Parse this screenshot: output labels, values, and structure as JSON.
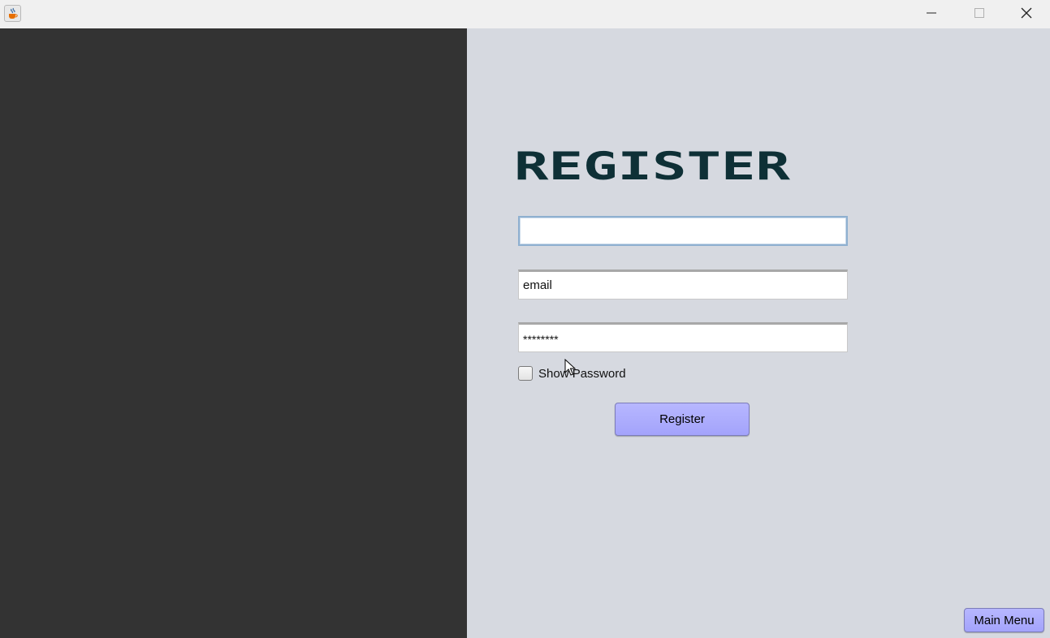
{
  "titlebar": {
    "app_icon": "java-cup-icon",
    "minimize_icon": "minimize-icon",
    "maximize_icon": "maximize-icon",
    "close_icon": "close-icon"
  },
  "form": {
    "title": "REGISTER",
    "username": {
      "value": "",
      "focused": true
    },
    "email": {
      "value": "email"
    },
    "password": {
      "value": "********"
    },
    "show_password": {
      "label": "Show Password",
      "checked": false
    },
    "register_button": "Register"
  },
  "footer": {
    "main_menu_button": "Main Menu"
  },
  "colors": {
    "left_panel": "#333333",
    "right_panel": "#d6d9e0",
    "title": "#0e3036",
    "button": "#a8a8fc"
  }
}
